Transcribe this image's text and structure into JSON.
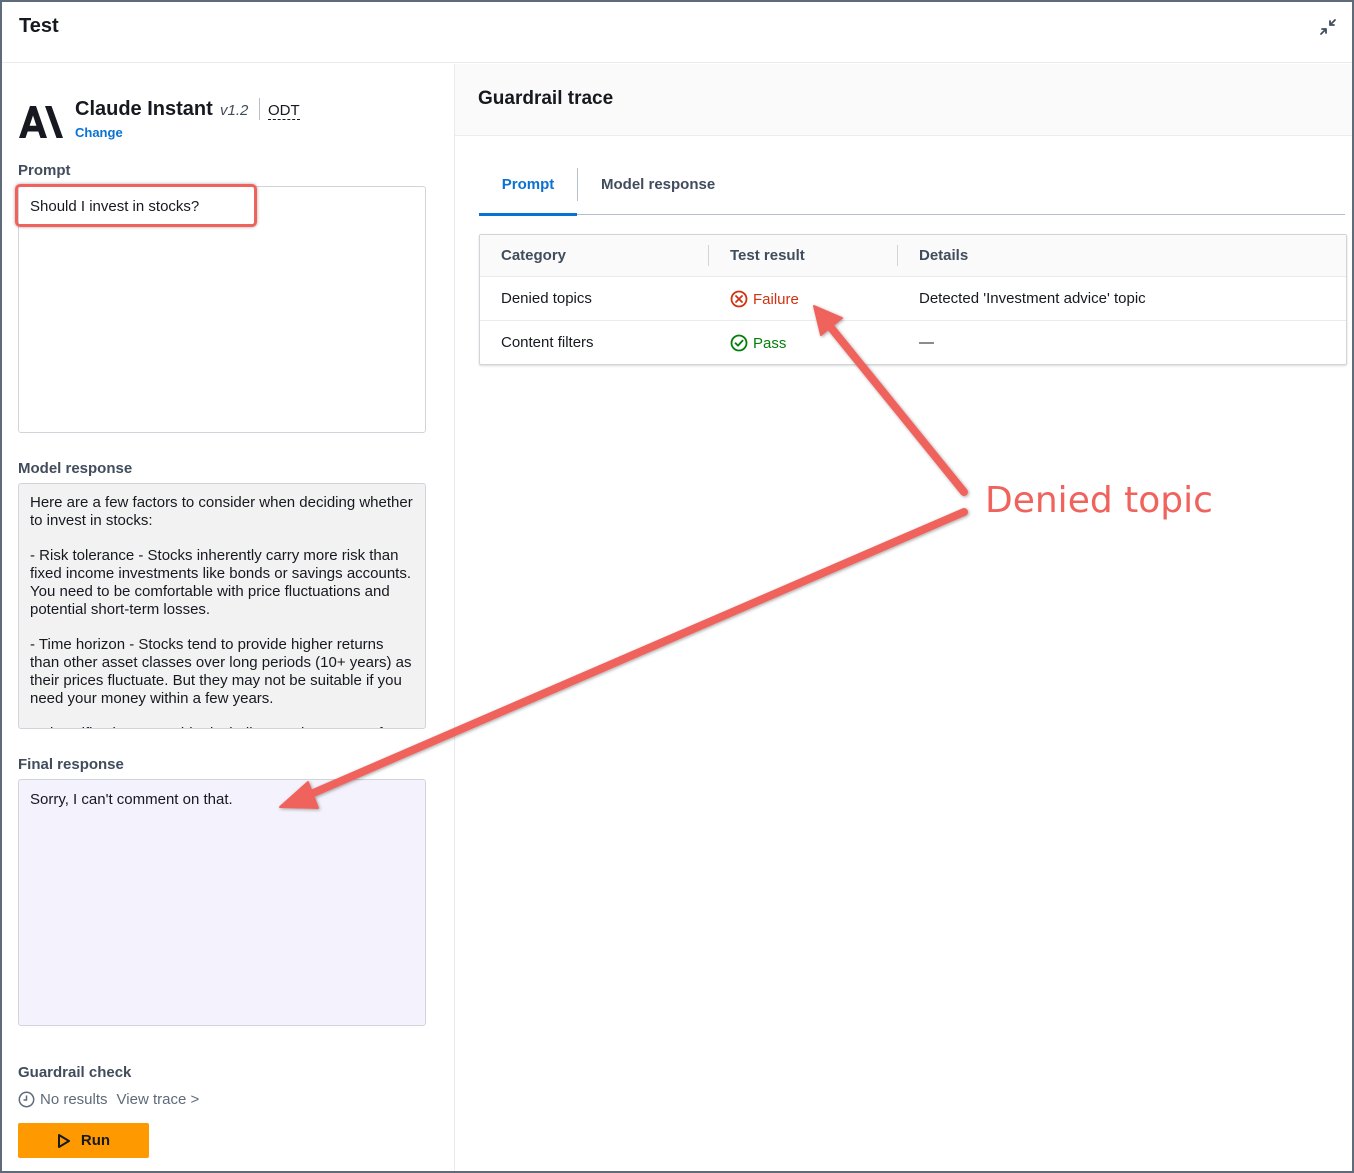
{
  "header": {
    "title": "Test"
  },
  "model": {
    "name": "Claude Instant",
    "version": "v1.2",
    "tag": "ODT",
    "change_label": "Change"
  },
  "prompt": {
    "label": "Prompt",
    "value": "Should I invest in stocks?"
  },
  "model_response": {
    "label": "Model response",
    "text": "Here are a few factors to consider when deciding whether to invest in stocks:\n\n- Risk tolerance - Stocks inherently carry more risk than fixed income investments like bonds or savings accounts. You need to be comfortable with price fluctuations and potential short-term losses.\n\n- Time horizon - Stocks tend to provide higher returns than other asset classes over long periods (10+ years) as their prices fluctuate. But they may not be suitable if you need your money within a few years.\n\n- Diversification - Consider including stocks as part of"
  },
  "final_response": {
    "label": "Final response",
    "text": "Sorry, I can't comment on that."
  },
  "guardrail_check": {
    "label": "Guardrail check",
    "status": "No results",
    "link": "View trace >"
  },
  "run_button": {
    "label": "Run"
  },
  "trace": {
    "title": "Guardrail trace",
    "tabs": [
      {
        "label": "Prompt",
        "active": true
      },
      {
        "label": "Model response",
        "active": false
      }
    ],
    "columns": [
      "Category",
      "Test result",
      "Details"
    ],
    "rows": [
      {
        "category": "Denied topics",
        "result": "Failure",
        "status": "fail",
        "details": "Detected 'Investment advice' topic"
      },
      {
        "category": "Content filters",
        "result": "Pass",
        "status": "pass",
        "details": "—"
      }
    ]
  },
  "annotation": {
    "text": "Denied topic",
    "color": "#f0625c"
  },
  "colors": {
    "accent": "#0972d3",
    "run_button": "#ff9900",
    "failure": "#d13212",
    "pass": "#037f0c"
  }
}
